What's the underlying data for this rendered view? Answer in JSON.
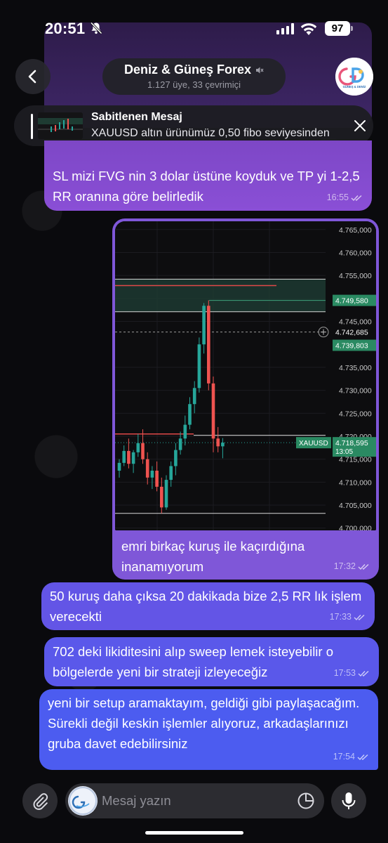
{
  "status_bar": {
    "time": "20:51",
    "battery": "97"
  },
  "header": {
    "title": "Deniz & Güneş Forex",
    "subtitle": "1.127 üye, 33 çevrimiçi",
    "avatar_text": "GÜNEŞ & DENİZ"
  },
  "pinned": {
    "title": "Sabitlenen Mesaj",
    "text": "XAUUSD altın ürünümüz 0,50 fibo seviyesinden"
  },
  "messages": [
    {
      "text": "SL mizi FVG nin 3 dolar üstüne koyduk ve TP yi 1-2,5 RR oranına göre belirledik",
      "time": "16:55"
    },
    {
      "text": "emri birkaç kuruş ile kaçırdığına inanamıyorum",
      "time": "17:32"
    },
    {
      "text": "50 kuruş daha çıksa 20 dakikada bize 2,5 RR lık işlem verecekti",
      "time": "17:33"
    },
    {
      "text": "702 deki likiditesini alıp sweep lemek isteyebilir o bölgelerde yeni bir strateji izleyeceğiz",
      "time": "17:53"
    },
    {
      "text": "yeni bir setup aramaktayım, geldiği gibi paylaşacağım. Sürekli değil keskin işlemler alıyoruz, arkadaşlarınızı gruba davet edebilirsiniz",
      "time": "17:54"
    }
  ],
  "composer": {
    "placeholder": "Mesaj yazın"
  },
  "colors": {
    "bubble_top": "#8a4fd6",
    "bubble_bottom": "#4c5cf0",
    "candle_up": "#26a69a",
    "candle_down": "#ef5350"
  },
  "icons": [
    "bell-off-icon",
    "signal-icon",
    "wifi-icon",
    "battery-icon",
    "chevron-left-icon",
    "mute-icon",
    "close-icon",
    "paperclip-icon",
    "sticker-icon",
    "microphone-icon",
    "double-check-icon"
  ],
  "chart_data": {
    "type": "candlestick",
    "symbol": "XAUUSD",
    "y_ticks": [
      "4.765,000",
      "4.760,000",
      "4.755,000",
      "4.750,000",
      "4.745,000",
      "4.735,000",
      "4.730,000",
      "4.725,000",
      "4.720,000",
      "4.715,000",
      "4.710,000",
      "4.705,000",
      "4.700,000"
    ],
    "y_tick_values": [
      4765,
      4760,
      4755,
      4750,
      4745,
      4735,
      4730,
      4725,
      4720,
      4715,
      4710,
      4705,
      4700
    ],
    "ylim": [
      4699.5,
      4766.8
    ],
    "price_labels": [
      {
        "text": "4.749,580",
        "value": 4749.58,
        "style": "green"
      },
      {
        "text": "4.742,685",
        "value": 4742.685,
        "style": "dark"
      },
      {
        "text": "4.739,803",
        "value": 4739.803,
        "style": "green"
      }
    ],
    "current": {
      "symbol": "XAUUSD",
      "price": "4.718,595",
      "countdown": "13:05",
      "value": 4718.595
    },
    "zone": {
      "top": 4754.2,
      "bottom": 4747.1
    },
    "lines": {
      "fvg_red": 4752.8,
      "zone_top": 4754.2,
      "zone_bottom": 4747.1,
      "tp": 4749.58,
      "dashed": 4742.685,
      "entry_red": 4720.5,
      "entry_white": 4720.2,
      "low": 4703.2
    },
    "candles": [
      {
        "o": 4712.5,
        "h": 4715.0,
        "l": 4711.0,
        "c": 4714.2
      },
      {
        "o": 4714.2,
        "h": 4718.0,
        "l": 4713.5,
        "c": 4716.8
      },
      {
        "o": 4716.8,
        "h": 4719.5,
        "l": 4713.0,
        "c": 4714.0
      },
      {
        "o": 4714.0,
        "h": 4717.0,
        "l": 4712.0,
        "c": 4716.5
      },
      {
        "o": 4716.5,
        "h": 4720.5,
        "l": 4715.5,
        "c": 4718.5
      },
      {
        "o": 4718.5,
        "h": 4721.5,
        "l": 4714.0,
        "c": 4715.0
      },
      {
        "o": 4715.0,
        "h": 4716.5,
        "l": 4709.5,
        "c": 4711.0
      },
      {
        "o": 4711.0,
        "h": 4713.5,
        "l": 4708.5,
        "c": 4712.5
      },
      {
        "o": 4712.5,
        "h": 4714.5,
        "l": 4708.0,
        "c": 4709.0
      },
      {
        "o": 4709.0,
        "h": 4711.0,
        "l": 4703.2,
        "c": 4704.5
      },
      {
        "o": 4704.5,
        "h": 4711.5,
        "l": 4704.0,
        "c": 4710.5
      },
      {
        "o": 4710.5,
        "h": 4714.5,
        "l": 4709.0,
        "c": 4713.5
      },
      {
        "o": 4713.5,
        "h": 4718.5,
        "l": 4711.5,
        "c": 4717.0
      },
      {
        "o": 4717.0,
        "h": 4721.0,
        "l": 4716.0,
        "c": 4719.5
      },
      {
        "o": 4719.5,
        "h": 4724.5,
        "l": 4718.0,
        "c": 4722.5
      },
      {
        "o": 4722.5,
        "h": 4728.5,
        "l": 4721.5,
        "c": 4727.0
      },
      {
        "o": 4727.0,
        "h": 4732.0,
        "l": 4725.0,
        "c": 4730.5
      },
      {
        "o": 4730.5,
        "h": 4741.5,
        "l": 4729.5,
        "c": 4740.0
      },
      {
        "o": 4740.0,
        "h": 4749.0,
        "l": 4738.0,
        "c": 4748.4
      },
      {
        "o": 4748.4,
        "h": 4749.6,
        "l": 4730.0,
        "c": 4731.5
      },
      {
        "o": 4731.5,
        "h": 4733.0,
        "l": 4716.5,
        "c": 4719.5
      },
      {
        "o": 4719.5,
        "h": 4722.0,
        "l": 4716.5,
        "c": 4717.8
      },
      {
        "o": 4717.8,
        "h": 4719.6,
        "l": 4715.2,
        "c": 4718.6
      }
    ]
  }
}
